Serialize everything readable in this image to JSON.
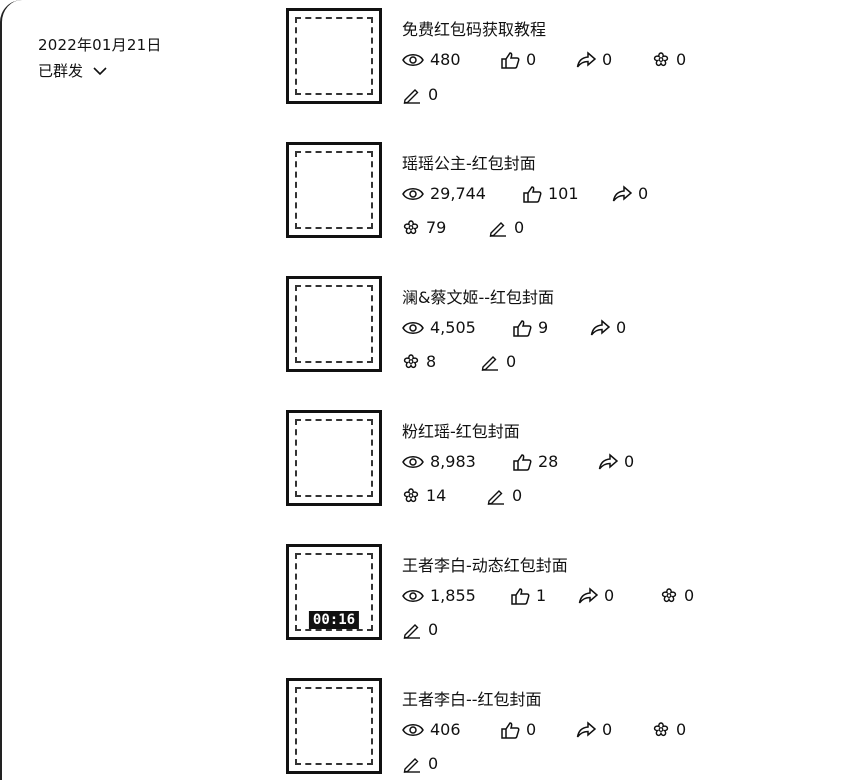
{
  "header": {
    "date": "2022年01月21日",
    "status": "已群发"
  },
  "items": [
    {
      "title": "免费红包码获取教程",
      "views": "480",
      "likes": "0",
      "shares": "0",
      "favorites": "0",
      "comments": "0"
    },
    {
      "title": "瑶瑶公主-红包封面",
      "views": "29,744",
      "likes": "101",
      "shares": "0",
      "favorites": "79",
      "comments": "0"
    },
    {
      "title": "澜&蔡文姬--红包封面",
      "views": "4,505",
      "likes": "9",
      "shares": "0",
      "favorites": "8",
      "comments": "0"
    },
    {
      "title": "粉红瑶-红包封面",
      "views": "8,983",
      "likes": "28",
      "shares": "0",
      "favorites": "14",
      "comments": "0"
    },
    {
      "title": "王者李白-动态红包封面",
      "views": "1,855",
      "likes": "1",
      "shares": "0",
      "favorites": "0",
      "comments": "0",
      "thumb_label": "00:16"
    },
    {
      "title": "王者李白--红包封面",
      "views": "406",
      "likes": "0",
      "shares": "0",
      "favorites": "0",
      "comments": "0"
    }
  ],
  "icons": {
    "views": "eye-icon",
    "likes": "thumbs-up-icon",
    "shares": "share-arrow-icon",
    "favorites": "flower-icon",
    "comments": "pencil-icon",
    "status": "chevron-down-icon"
  }
}
